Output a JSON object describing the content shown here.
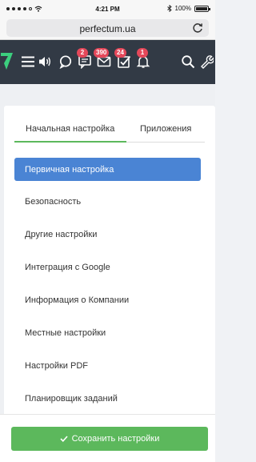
{
  "status_bar": {
    "time": "4:21 PM",
    "battery": "100%"
  },
  "browser": {
    "url": "perfectum.ua"
  },
  "nav": {
    "badges": {
      "messages": "2",
      "mail": "390",
      "tasks": "24",
      "notifications": "1"
    }
  },
  "settings": {
    "tabs": [
      "Начальная настройка",
      "Приложения"
    ],
    "menu": [
      "Первичная настройка",
      "Безопасность",
      "Другие настройки",
      "Интеграция с Google",
      "Информация о Компании",
      "Местные настройки",
      "Настройки PDF",
      "Планировщик заданий"
    ],
    "save_label": "Сохранить настройки"
  },
  "colors": {
    "nav_bg": "#323a45",
    "accent_green": "#5cb85c",
    "active_blue": "#4a84d4",
    "badge_red": "#e4485a",
    "logo_green": "#3ccf7e"
  }
}
